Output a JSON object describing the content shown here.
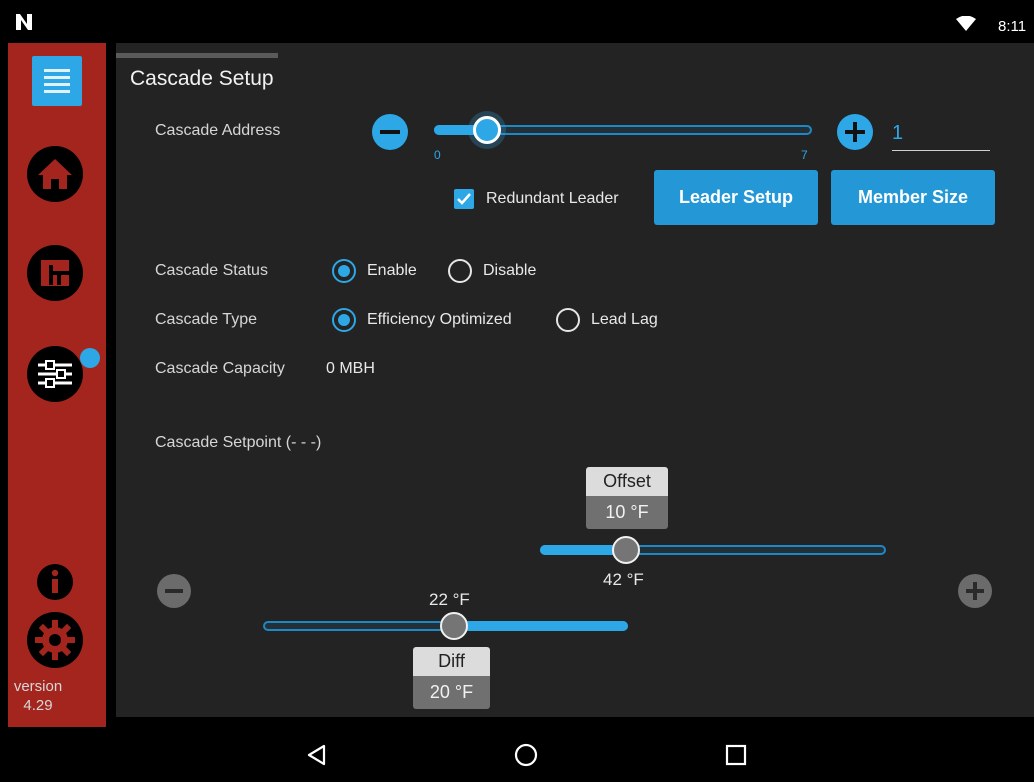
{
  "status_bar": {
    "time": "8:11"
  },
  "sidebar": {
    "items": [
      "menu",
      "home",
      "dashboard",
      "settings"
    ],
    "version_label": "version",
    "version_number": "4.29"
  },
  "page": {
    "title": "Cascade Setup",
    "cascade_address": {
      "label": "Cascade Address",
      "value": "1",
      "min": "0",
      "max": "7",
      "slider_value": 1
    },
    "redundant_leader": {
      "label": "Redundant Leader",
      "checked": true
    },
    "buttons": {
      "leader_setup": "Leader Setup",
      "member_size": "Member Size"
    },
    "cascade_status": {
      "label": "Cascade Status",
      "options": [
        "Enable",
        "Disable"
      ],
      "selected": "Enable"
    },
    "cascade_type": {
      "label": "Cascade Type",
      "options": [
        "Efficiency Optimized",
        "Lead Lag"
      ],
      "selected": "Efficiency Optimized"
    },
    "cascade_capacity": {
      "label": "Cascade Capacity",
      "value": "0 MBH"
    },
    "cascade_setpoint": {
      "label": "Cascade Setpoint (- - -)",
      "offset": {
        "label": "Offset",
        "value": "10 °F",
        "slider_value": "42 °F"
      },
      "diff": {
        "label": "Diff",
        "value": "20 °F",
        "slider_value": "22 °F"
      }
    }
  },
  "colors": {
    "accent": "#2ea7e6",
    "sidebar": "#a3251d",
    "panel": "#232323"
  }
}
